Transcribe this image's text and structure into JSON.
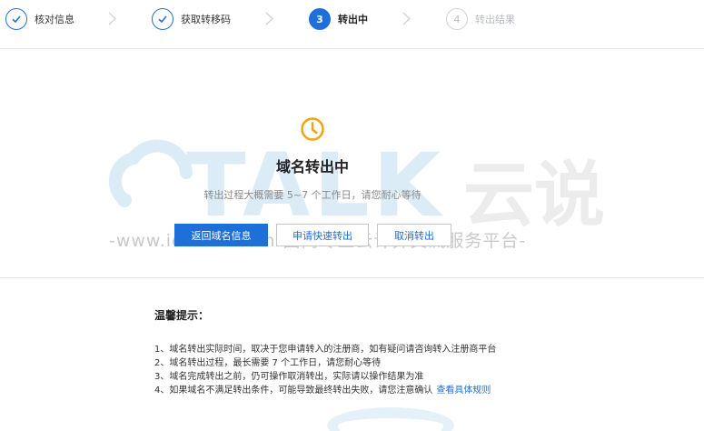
{
  "steps": [
    {
      "label": "核对信息",
      "state": "done"
    },
    {
      "label": "获取转移码",
      "state": "done"
    },
    {
      "number": "3",
      "label": "转出中",
      "state": "current"
    },
    {
      "number": "4",
      "label": "转出结果",
      "state": "todo"
    }
  ],
  "status": {
    "title": "域名转出中",
    "subtitle": "转出过程大概需要 5~7 个工作日，请您耐心等待"
  },
  "buttons": {
    "back": "返回域名信息",
    "apply_fast": "申请快速转出",
    "cancel": "取消转出"
  },
  "tips": {
    "title": "温馨提示：",
    "items": [
      "1、域名转出实际时间，取决于您申请转入的注册商，如有疑问请咨询转入注册商平台",
      "2、域名转出过程，最长需要 7 个工作日，请您耐心等待",
      "3、域名完成转出之前，仍可操作取消转出，实际请以操作结果为准",
      "4、如果域名不满足转出条件，可能导致最终转出失败，请您注意确认"
    ],
    "link": "查看具体规则"
  },
  "watermark": {
    "brand": "TALK",
    "brand_cn": "云说",
    "url_line": "-www.idctalk.com-国内专业云计算交流服务平台-"
  },
  "colors": {
    "primary": "#1f6fdb",
    "clock": "#f0a30a",
    "watermark_blue": "#dcecf6"
  },
  "icons": {
    "done": "check-icon",
    "separator": "chevron-right-icon",
    "status": "clock-icon"
  }
}
